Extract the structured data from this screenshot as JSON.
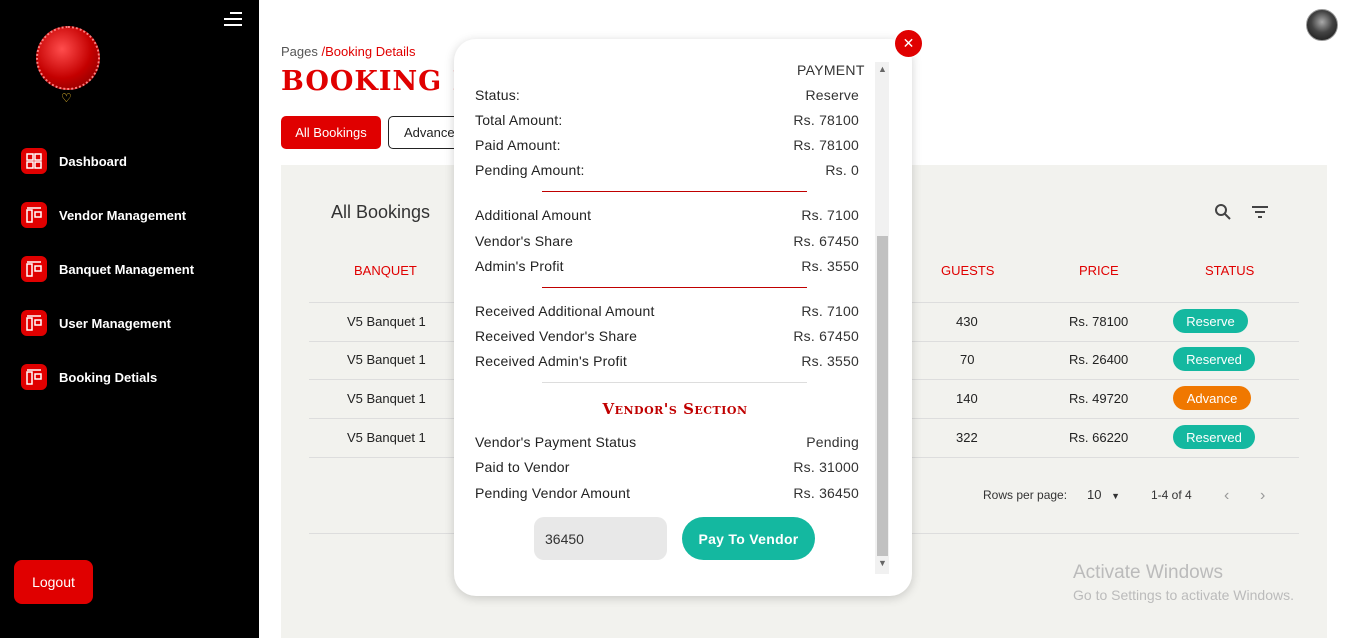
{
  "sidebar": {
    "items": [
      {
        "label": "Dashboard"
      },
      {
        "label": "Vendor Management"
      },
      {
        "label": "Banquet Management"
      },
      {
        "label": "User Management"
      },
      {
        "label": "Booking Detials"
      }
    ],
    "logout_label": "Logout"
  },
  "header": {
    "breadcrumb_root": "Pages",
    "breadcrumb_current": "/Booking Details",
    "title": "BOOKING D",
    "tab_all": "All Bookings",
    "tab_advance": "Advance"
  },
  "panel": {
    "title": "All Bookings",
    "columns": {
      "banquet": "BANQUET",
      "guests": "GUESTS",
      "price": "PRICE",
      "status": "STATUS"
    },
    "rows": [
      {
        "banquet": "V5 Banquet 1",
        "guests": "430",
        "price": "Rs. 78100",
        "status": "Reserve",
        "status_color": "#14b8a0"
      },
      {
        "banquet": "V5 Banquet 1",
        "guests": "70",
        "price": "Rs. 26400",
        "status": "Reserved",
        "status_color": "#14b8a0"
      },
      {
        "banquet": "V5 Banquet 1",
        "guests": "140",
        "price": "Rs. 49720",
        "status": "Advance",
        "status_color": "#f07800"
      },
      {
        "banquet": "V5 Banquet 1",
        "guests": "322",
        "price": "Rs. 66220",
        "status": "Reserved",
        "status_color": "#14b8a0"
      }
    ],
    "rows_per_page_label": "Rows per page:",
    "rows_per_page_value": "10",
    "range_label": "1-4 of 4"
  },
  "watermark": {
    "line1": "Activate Windows",
    "line2": "Go to Settings to activate Windows."
  },
  "modal": {
    "header": "PAYMENT",
    "payment": [
      {
        "key": "Status:",
        "value": "Reserve"
      },
      {
        "key": "Total Amount:",
        "value": "Rs. 78100"
      },
      {
        "key": "Paid Amount:",
        "value": "Rs. 78100"
      },
      {
        "key": "Pending Amount:",
        "value": "Rs. 0"
      }
    ],
    "shares": [
      {
        "key": "Additional Amount",
        "value": "Rs. 7100"
      },
      {
        "key": "Vendor's Share",
        "value": "Rs. 67450"
      },
      {
        "key": "Admin's Profit",
        "value": "Rs. 3550"
      }
    ],
    "received": [
      {
        "key": "Received Additional Amount",
        "value": "Rs. 7100"
      },
      {
        "key": "Received Vendor's Share",
        "value": "Rs. 67450"
      },
      {
        "key": "Received Admin's Profit",
        "value": "Rs. 3550"
      }
    ],
    "vendor_section_title": "Vendor's Section",
    "vendor": [
      {
        "key": "Vendor's Payment Status",
        "value": "Pending"
      },
      {
        "key": "Paid to Vendor",
        "value": "Rs. 31000"
      },
      {
        "key": "Pending Vendor Amount",
        "value": "Rs. 36450"
      }
    ],
    "amount_input_value": "36450",
    "pay_button_label": "Pay To Vendor",
    "close_symbol": "✕"
  },
  "colors": {
    "accent": "#e00000",
    "teal": "#14b8a0",
    "orange": "#f07800"
  }
}
